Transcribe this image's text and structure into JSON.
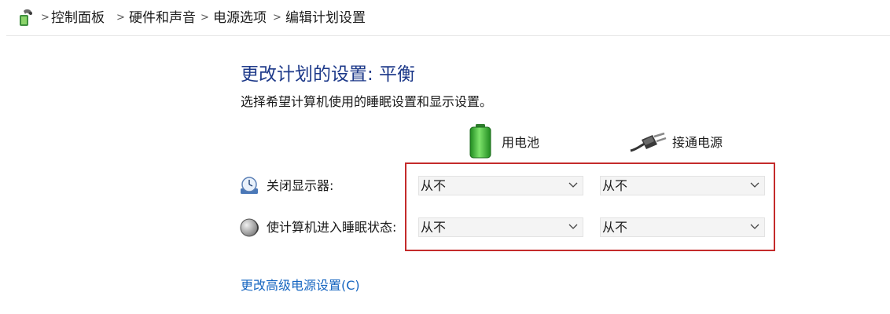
{
  "breadcrumb": {
    "items": [
      "控制面板",
      "硬件和声音",
      "电源选项",
      "编辑计划设置"
    ],
    "separator": ">"
  },
  "page": {
    "title": "更改计划的设置: 平衡",
    "subtitle": "选择希望计算机使用的睡眠设置和显示设置。"
  },
  "columns": {
    "battery": {
      "label": "用电池",
      "icon": "battery-icon"
    },
    "plugged": {
      "label": "接通电源",
      "icon": "power-plug-icon"
    }
  },
  "rows": {
    "display": {
      "label": "关闭显示器:",
      "icon": "display-timer-icon",
      "battery_value": "从不",
      "plugged_value": "从不"
    },
    "sleep": {
      "label": "使计算机进入睡眠状态:",
      "icon": "sleep-moon-icon",
      "battery_value": "从不",
      "plugged_value": "从不"
    }
  },
  "links": {
    "advanced": "更改高级电源设置(C)"
  },
  "colors": {
    "title": "#1e3a8a",
    "link": "#1565c0",
    "highlight_box": "#c42b2b",
    "battery_green": "#3cb043"
  }
}
